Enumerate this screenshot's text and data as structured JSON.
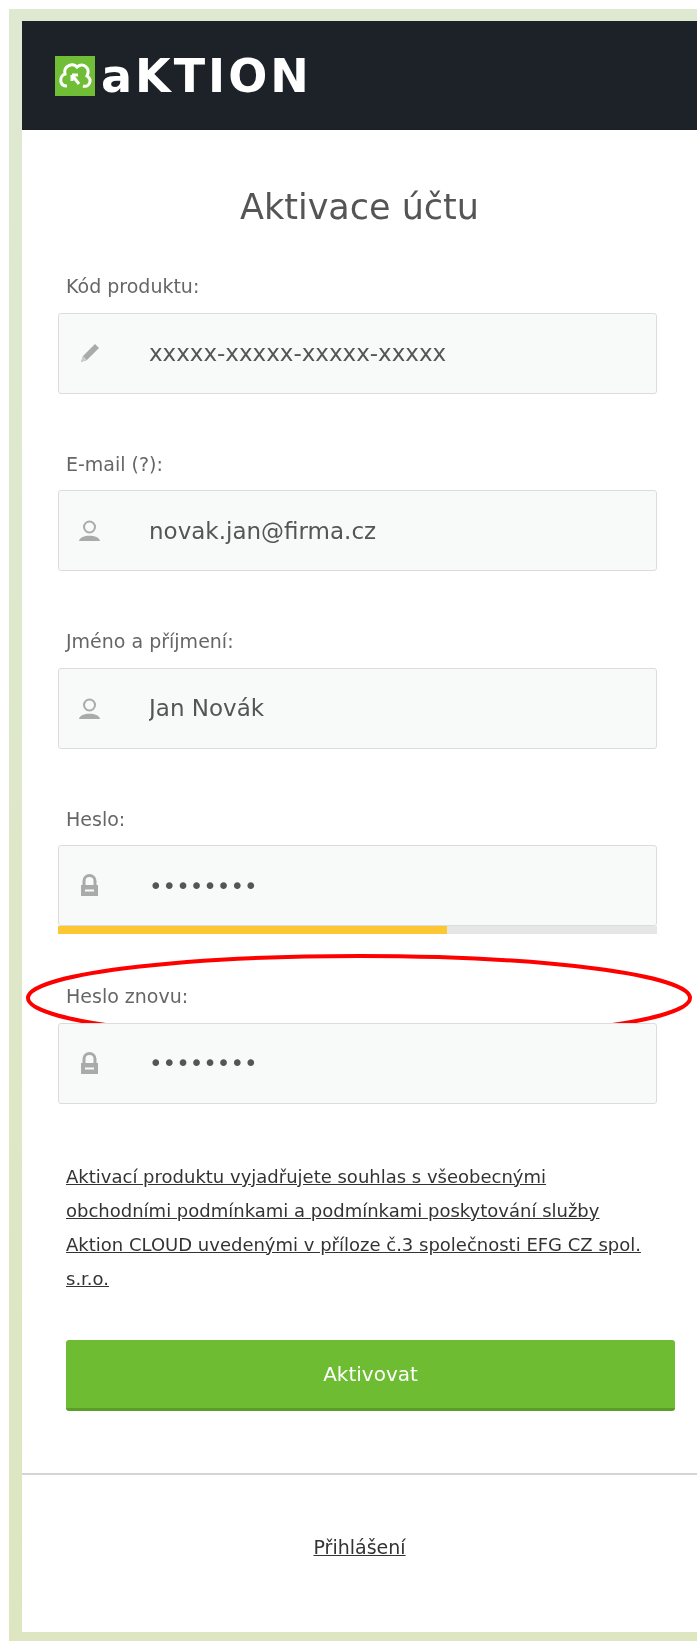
{
  "header": {
    "logo_text": "aKTION"
  },
  "title": "Aktivace účtu",
  "fields": [
    {
      "kind": "code",
      "label": "Kód produktu:",
      "value": "xxxxx-xxxxx-xxxxx-xxxxx",
      "highlighted": false
    },
    {
      "kind": "person",
      "label": "E-mail (?):",
      "value": "novak.jan@firma.cz",
      "highlighted": false
    },
    {
      "kind": "person",
      "label": "Jméno a příjmení:",
      "value": "Jan Novák",
      "highlighted": false
    },
    {
      "kind": "password",
      "label": "Heslo:",
      "value": "••••••••",
      "highlighted": false,
      "level": 0.65
    },
    {
      "kind": "password",
      "label": "Heslo znovu:",
      "value": "••••••••",
      "highlighted": true
    }
  ],
  "terms_link": "Aktivací produktu vyjadřujete souhlas s všeobecnými obchodními podmínkami a podmínkami poskytování služby Aktion CLOUD uvedenými v příloze č.3 společnosti EFG CZ spol. s.r.o.",
  "submit_button": "Aktivovat",
  "login_link": "Přihlášení"
}
